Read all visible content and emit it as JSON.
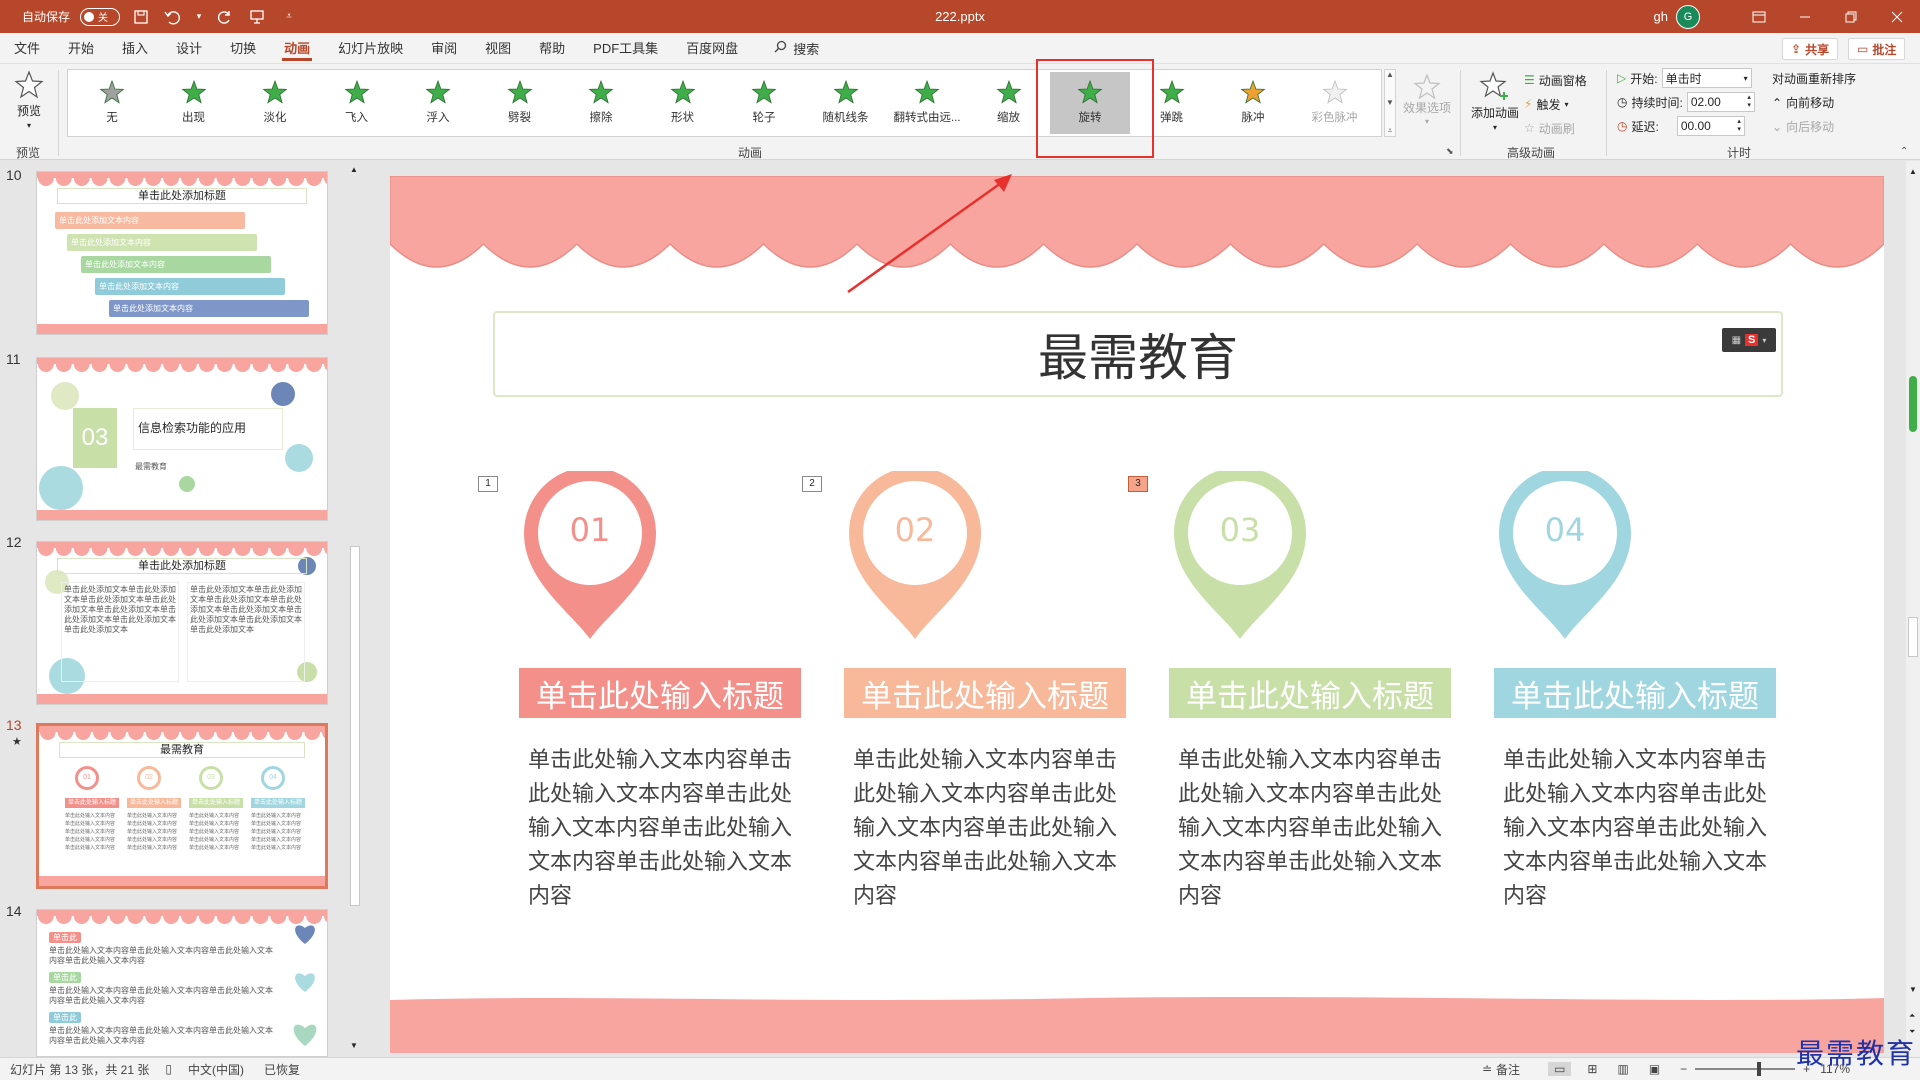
{
  "titlebar": {
    "autosave_label": "自动保存",
    "autosave_state": "关",
    "doc_title": "222.pptx",
    "user_initials": "gh",
    "avatar_letter": "G"
  },
  "menu": {
    "tabs": [
      "文件",
      "开始",
      "插入",
      "设计",
      "切换",
      "动画",
      "幻灯片放映",
      "审阅",
      "视图",
      "帮助",
      "PDF工具集",
      "百度网盘"
    ],
    "active_tab": "动画",
    "search_label": "搜索",
    "share_label": "共享",
    "comment_label": "批注"
  },
  "ribbon": {
    "preview_label": "预览",
    "preview_group": "预览",
    "animation_group": "动画",
    "advanced_group": "高级动画",
    "timing_group": "计时",
    "animations": [
      {
        "label": "无",
        "color": "#a0a0a0",
        "state": "normal"
      },
      {
        "label": "出现",
        "color": "#3fae49",
        "state": "normal"
      },
      {
        "label": "淡化",
        "color": "#3fae49",
        "state": "normal"
      },
      {
        "label": "飞入",
        "color": "#3fae49",
        "state": "normal"
      },
      {
        "label": "浮入",
        "color": "#3fae49",
        "state": "normal"
      },
      {
        "label": "劈裂",
        "color": "#3fae49",
        "state": "normal"
      },
      {
        "label": "擦除",
        "color": "#3fae49",
        "state": "normal"
      },
      {
        "label": "形状",
        "color": "#3fae49",
        "state": "normal"
      },
      {
        "label": "轮子",
        "color": "#3fae49",
        "state": "normal"
      },
      {
        "label": "随机线条",
        "color": "#3fae49",
        "state": "normal"
      },
      {
        "label": "翻转式由远...",
        "color": "#3fae49",
        "state": "normal"
      },
      {
        "label": "缩放",
        "color": "#3fae49",
        "state": "normal"
      },
      {
        "label": "旋转",
        "color": "#3fae49",
        "state": "selected"
      },
      {
        "label": "弹跳",
        "color": "#3fae49",
        "state": "normal"
      },
      {
        "label": "脉冲",
        "color": "#f0a030",
        "state": "normal"
      },
      {
        "label": "彩色脉冲",
        "color": "#c8c8c8",
        "state": "disabled"
      }
    ],
    "effect_options_label": "效果选项",
    "add_animation_label": "添加动画",
    "animation_pane_label": "动画窗格",
    "trigger_label": "触发",
    "painter_label": "动画刷",
    "start_label": "开始:",
    "start_value": "单击时",
    "duration_label": "持续时间:",
    "duration_value": "02.00",
    "delay_label": "延迟:",
    "delay_value": "00.00",
    "reorder_label": "对动画重新排序",
    "move_earlier_label": "向前移动",
    "move_later_label": "向后移动"
  },
  "thumbnails": [
    {
      "number": "10",
      "title": "单击此处添加标题",
      "bars": [
        "单击此处添加文本内容",
        "单击此处添加文本内容",
        "单击此处添加文本内容",
        "单击此处添加文本内容",
        "单击此处添加文本内容"
      ]
    },
    {
      "number": "11",
      "section_num": "03",
      "heading": "信息检索功能的应用",
      "sub": "最需教育"
    },
    {
      "number": "12",
      "title": "单击此处添加标题",
      "text_block": "单击此处添加文本单击此处添加文本单击此处添加文本单击此处添加文本单击此处添加文本单击此处添加文本单击此处添加文本单击此处添加文本"
    },
    {
      "number": "13",
      "star": "★",
      "title": "最需教育",
      "nums": [
        "01",
        "02",
        "03",
        "04"
      ],
      "card_title": "单击此处输入标题"
    },
    {
      "number": "14",
      "tags": [
        "单击此处",
        "单击此处",
        "单击此处"
      ],
      "text_block": "单击此处输入文本内容单击此处输入文本内容单击此处输入文本内容单击此处输入文本内容"
    }
  ],
  "slide": {
    "title": "最需教育",
    "tags": [
      "1",
      "2",
      "3"
    ],
    "cards": [
      {
        "num": "01",
        "color": "#f4908a",
        "title": "单击此处输入标题",
        "text": "单击此处输入文本内容单击此处输入文本内容单击此处输入文本内容单击此处输入文本内容单击此处输入文本内容"
      },
      {
        "num": "02",
        "color": "#f8b89a",
        "title": "单击此处输入标题",
        "text": "单击此处输入文本内容单击此处输入文本内容单击此处输入文本内容单击此处输入文本内容单击此处输入文本内容"
      },
      {
        "num": "03",
        "color": "#c8e0a8",
        "title": "单击此处输入标题",
        "text": "单击此处输入文本内容单击此处输入文本内容单击此处输入文本内容单击此处输入文本内容单击此处输入文本内容"
      },
      {
        "num": "04",
        "color": "#9fd6e0",
        "title": "单击此处输入标题",
        "text": "单击此处输入文本内容单击此处输入文本内容单击此处输入文本内容单击此处输入文本内容单击此处输入文本内容"
      }
    ]
  },
  "status": {
    "slide_info": "幻灯片 第 13 张，共 21 张",
    "language": "中文(中国)",
    "recovered": "已恢复",
    "notes_label": "备注",
    "zoom": "117%"
  },
  "watermark": "最需教育",
  "colors": {
    "accent": "#b7472a",
    "scallop": "#f8a5a0",
    "highlight": "#e8312c"
  }
}
